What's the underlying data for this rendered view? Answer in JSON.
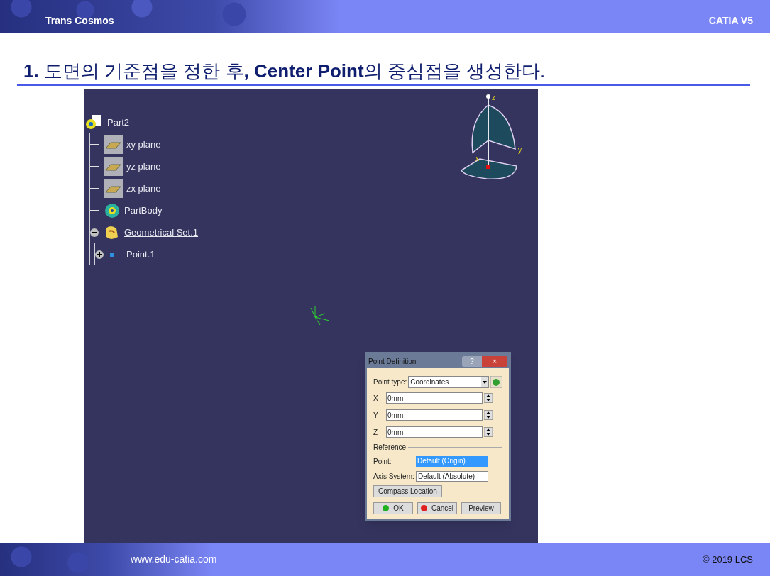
{
  "header": {
    "left": "Trans Cosmos",
    "right": "CATIA V5"
  },
  "title": "**1.** 도면의 기준점을 정한 후**,** **Center Point**의 중심점을 생성한다.",
  "tree": {
    "label": "Part2",
    "kind": "part",
    "children": [
      {
        "label": "xy plane",
        "kind": "plane"
      },
      {
        "label": "yz plane",
        "kind": "plane"
      },
      {
        "label": "zx plane",
        "kind": "plane"
      },
      {
        "label": "PartBody",
        "kind": "body"
      },
      {
        "label": "Geometrical Set.1",
        "kind": "set",
        "expanded": true,
        "children": [
          {
            "label": "Point.1",
            "kind": "point",
            "expanded": false
          }
        ]
      }
    ]
  },
  "compass": {
    "axes": [
      "z",
      "y",
      "x"
    ]
  },
  "dialog": {
    "title": "Point Definition",
    "help": "?",
    "close": "×",
    "point_type": {
      "label": "Point type:",
      "value": "Coordinates"
    },
    "fields": [
      {
        "label": "X =",
        "value": "0mm"
      },
      {
        "label": "Y =",
        "value": "0mm"
      },
      {
        "label": "Z =",
        "value": "0mm"
      }
    ],
    "section": "Reference",
    "reference": [
      {
        "label": "Point:",
        "value": "Default (Origin)",
        "selected": true
      },
      {
        "label": "Axis System:",
        "value": "Default (Absolute)",
        "selected": false
      }
    ],
    "compass_button": "Compass Location",
    "buttons": [
      {
        "label": "OK",
        "kind": "ok"
      },
      {
        "label": "Cancel",
        "kind": "cancel"
      },
      {
        "label": "Preview",
        "kind": "plain"
      }
    ]
  },
  "footer": {
    "left": "www.edu-catia.com",
    "right": "© 2019 LCS"
  }
}
